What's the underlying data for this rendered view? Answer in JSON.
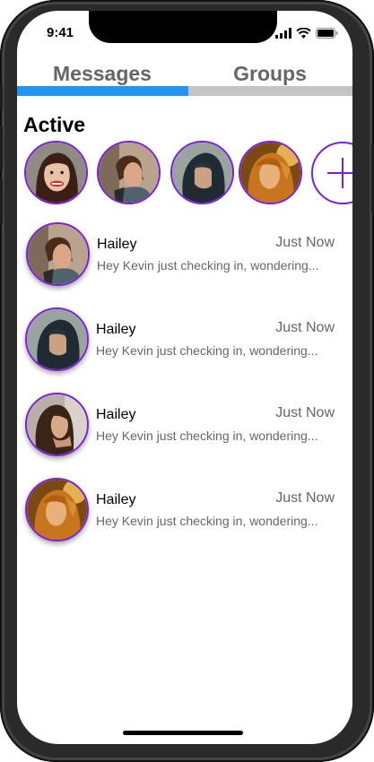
{
  "status_bar": {
    "time": "9:41",
    "icons": [
      "signal-icon",
      "wifi-icon",
      "battery-icon"
    ]
  },
  "tabs": [
    {
      "label": "Messages",
      "active": true
    },
    {
      "label": "Groups",
      "active": false
    }
  ],
  "active_section": {
    "title": "Active",
    "users": [
      {
        "avatar": "woman-smiling-photo"
      },
      {
        "avatar": "woman-ponytail-photo"
      },
      {
        "avatar": "hooded-person-photo"
      },
      {
        "avatar": "woman-golden-light-photo"
      }
    ],
    "add_icon": "plus-icon"
  },
  "chats": [
    {
      "name": "Hailey",
      "time": "Just Now",
      "preview": "Hey Kevin just checking in, wondering...",
      "avatar": "woman-ponytail-photo"
    },
    {
      "name": "Hailey",
      "time": "Just Now",
      "preview": "Hey Kevin just checking in, wondering...",
      "avatar": "hooded-person-photo"
    },
    {
      "name": "Hailey",
      "time": "Just Now",
      "preview": "Hey Kevin just checking in, wondering...",
      "avatar": "woman-long-hair-photo"
    },
    {
      "name": "Hailey",
      "time": "Just Now",
      "preview": "Hey Kevin just checking in, wondering...",
      "avatar": "woman-golden-light-photo"
    }
  ],
  "colors": {
    "accent": "#2196f3",
    "avatar_ring": "#7b1fd9",
    "tab_inactive": "#c4c4c4",
    "muted_text": "#666666"
  }
}
